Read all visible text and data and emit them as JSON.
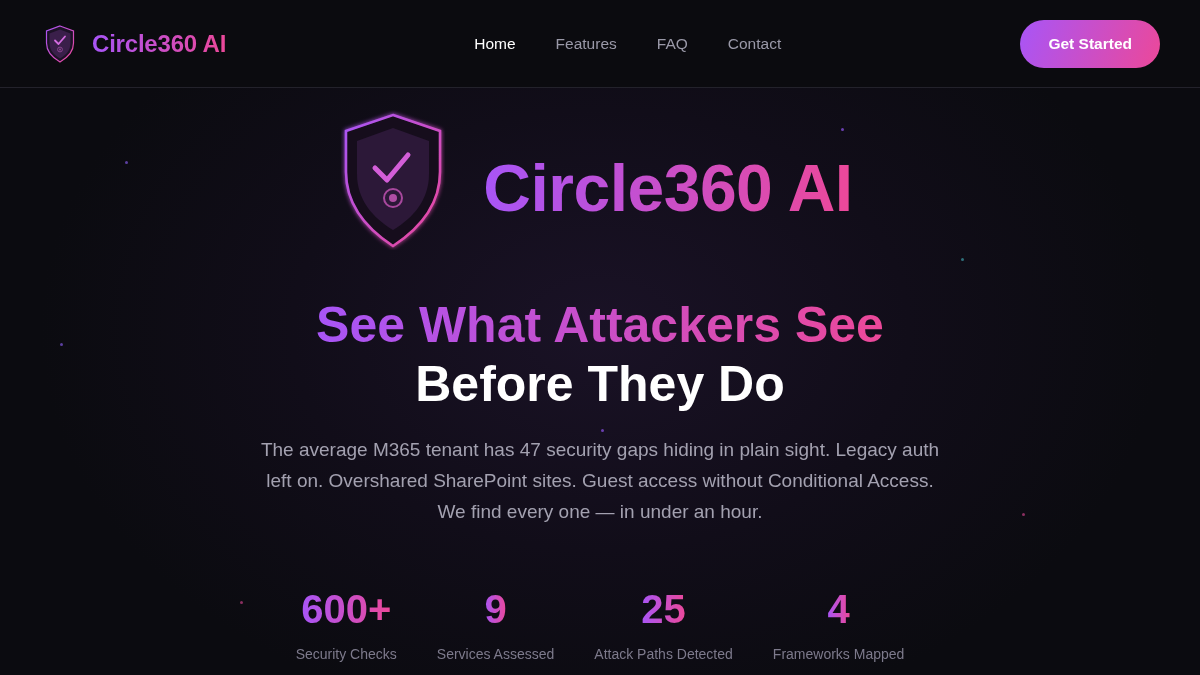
{
  "nav": {
    "brand": "Circle360 AI",
    "links": [
      {
        "label": "Home",
        "selected": true
      },
      {
        "label": "Features",
        "selected": false
      },
      {
        "label": "FAQ",
        "selected": false
      },
      {
        "label": "Contact",
        "selected": false
      }
    ],
    "cta": "Get Started"
  },
  "hero": {
    "title": "Circle360 AI",
    "headline": [
      {
        "text": "See What Attackers See",
        "kind": "gradient"
      },
      {
        "text": "Before They Do",
        "kind": "plain"
      }
    ],
    "description": "The average M365 tenant has 47 security gaps hiding in plain sight. Legacy auth left on. Overshared SharePoint sites. Guest access without Conditional Access. We find every one — in under an hour.",
    "stats": [
      {
        "value": "600+",
        "label": "Security Checks"
      },
      {
        "value": "9",
        "label": "Services Assessed"
      },
      {
        "value": "25",
        "label": "Attack Paths Detected"
      },
      {
        "value": "4",
        "label": "Frameworks Mapped"
      }
    ]
  }
}
